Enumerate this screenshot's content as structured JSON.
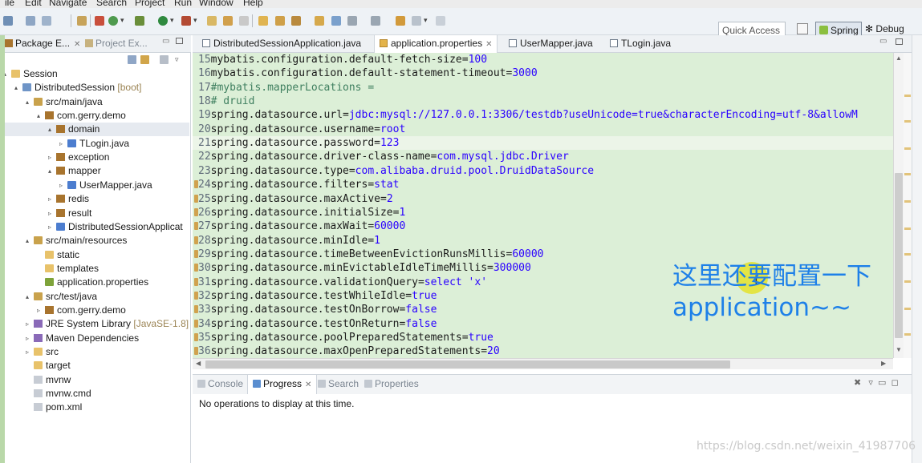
{
  "menubar": {
    "items": [
      "ile",
      "Edit",
      "Navigate",
      "Search",
      "Project",
      "Run",
      "Window",
      "Help"
    ]
  },
  "toolbar": {
    "quick_access_placeholder": "Quick Access",
    "perspectives": {
      "spring_label": "Spring",
      "debug_label": "Debug"
    }
  },
  "left_panel": {
    "tabs": [
      {
        "label": "Package E...",
        "icon": "package-explorer-icon"
      },
      {
        "label": "Project Ex...",
        "icon": "project-explorer-icon"
      }
    ],
    "tree": [
      {
        "label": "Session",
        "twisty": "▴",
        "icon": "folder-icon",
        "icon_class": "ti-folder"
      },
      {
        "label": "DistributedSession",
        "suffix": "[boot]",
        "twisty": "▴",
        "icon": "project-icon",
        "icon_class": "ti-proj"
      },
      {
        "label": "src/main/java",
        "twisty": "▴",
        "icon": "source-folder-icon",
        "icon_class": "ti-src"
      },
      {
        "label": "com.gerry.demo",
        "twisty": "▴",
        "icon": "package-icon",
        "icon_class": "ti-pkg"
      },
      {
        "label": "domain",
        "twisty": "▴",
        "icon": "package-icon",
        "icon_class": "ti-pkg",
        "selected": true
      },
      {
        "label": "TLogin.java",
        "twisty": "▹",
        "icon": "java-file-icon",
        "icon_class": "ti-java"
      },
      {
        "label": "exception",
        "twisty": "▹",
        "icon": "package-icon",
        "icon_class": "ti-pkg"
      },
      {
        "label": "mapper",
        "twisty": "▴",
        "icon": "package-icon",
        "icon_class": "ti-pkg"
      },
      {
        "label": "UserMapper.java",
        "twisty": "▹",
        "icon": "java-interface-icon",
        "icon_class": "ti-java"
      },
      {
        "label": "redis",
        "twisty": "▹",
        "icon": "package-icon",
        "icon_class": "ti-pkg"
      },
      {
        "label": "result",
        "twisty": "▹",
        "icon": "package-icon",
        "icon_class": "ti-pkg"
      },
      {
        "label": "DistributedSessionApplicat",
        "twisty": "▹",
        "icon": "java-file-icon",
        "icon_class": "ti-java"
      },
      {
        "label": "src/main/resources",
        "twisty": "▴",
        "icon": "source-folder-icon",
        "icon_class": "ti-src"
      },
      {
        "label": "static",
        "twisty": "",
        "icon": "folder-icon",
        "icon_class": "ti-folder"
      },
      {
        "label": "templates",
        "twisty": "",
        "icon": "folder-icon",
        "icon_class": "ti-folder"
      },
      {
        "label": "application.properties",
        "twisty": "",
        "icon": "properties-file-icon",
        "icon_class": "ti-props"
      },
      {
        "label": "src/test/java",
        "twisty": "▴",
        "icon": "source-folder-icon",
        "icon_class": "ti-src"
      },
      {
        "label": "com.gerry.demo",
        "twisty": "▹",
        "icon": "package-icon",
        "icon_class": "ti-pkg"
      },
      {
        "label": "JRE System Library",
        "suffix": "[JavaSE-1.8]",
        "twisty": "▹",
        "icon": "library-icon",
        "icon_class": "ti-lib"
      },
      {
        "label": "Maven Dependencies",
        "twisty": "▹",
        "icon": "library-icon",
        "icon_class": "ti-lib"
      },
      {
        "label": "src",
        "twisty": "▹",
        "icon": "folder-icon",
        "icon_class": "ti-folder"
      },
      {
        "label": "target",
        "twisty": "",
        "icon": "folder-icon",
        "icon_class": "ti-folder"
      },
      {
        "label": "mvnw",
        "twisty": "",
        "icon": "file-icon",
        "icon_class": "ti-file"
      },
      {
        "label": "mvnw.cmd",
        "twisty": "",
        "icon": "file-icon",
        "icon_class": "ti-file"
      },
      {
        "label": "pom.xml",
        "twisty": "",
        "icon": "xml-file-icon",
        "icon_class": "ti-file"
      }
    ]
  },
  "editor": {
    "tabs": [
      {
        "label": "DistributedSessionApplication.java",
        "active": false
      },
      {
        "label": "application.properties",
        "active": true
      },
      {
        "label": "UserMapper.java",
        "active": false
      },
      {
        "label": "TLogin.java",
        "active": false
      }
    ],
    "current_line": 21,
    "lines": [
      {
        "n": "15",
        "key": "mybatis.configuration.default-fetch-size",
        "val": "100"
      },
      {
        "n": "16",
        "key": "mybatis.configuration.default-statement-timeout",
        "val": "3000"
      },
      {
        "n": "17",
        "comment": "#mybatis.mapperLocations ="
      },
      {
        "n": "18",
        "comment": "# druid"
      },
      {
        "n": "19",
        "key": "spring.datasource.url",
        "val": "jdbc:mysql://127.0.0.1:3306/testdb?useUnicode=true&characterEncoding=utf-8&allowM"
      },
      {
        "n": "20",
        "key": "spring.datasource.username",
        "val": "root"
      },
      {
        "n": "21",
        "key": "spring.datasource.password",
        "val": "123"
      },
      {
        "n": "22",
        "key": "spring.datasource.driver-class-name",
        "val": "com.mysql.jdbc.Driver"
      },
      {
        "n": "23",
        "key": "spring.datasource.type",
        "val": "com.alibaba.druid.pool.DruidDataSource"
      },
      {
        "n": "24",
        "key": "spring.datasource.filters",
        "val": "stat",
        "marker": true
      },
      {
        "n": "25",
        "key": "spring.datasource.maxActive",
        "val": "2",
        "marker": true
      },
      {
        "n": "26",
        "key": "spring.datasource.initialSize",
        "val": "1",
        "marker": true
      },
      {
        "n": "27",
        "key": "spring.datasource.maxWait",
        "val": "60000",
        "marker": true
      },
      {
        "n": "28",
        "key": "spring.datasource.minIdle",
        "val": "1",
        "marker": true
      },
      {
        "n": "29",
        "key": "spring.datasource.timeBetweenEvictionRunsMillis",
        "val": "60000",
        "marker": true
      },
      {
        "n": "30",
        "key": "spring.datasource.minEvictableIdleTimeMillis",
        "val": "300000",
        "marker": true
      },
      {
        "n": "31",
        "key": "spring.datasource.validationQuery",
        "val": "select 'x'",
        "marker": true
      },
      {
        "n": "32",
        "key": "spring.datasource.testWhileIdle",
        "val": "true",
        "marker": true
      },
      {
        "n": "33",
        "key": "spring.datasource.testOnBorrow",
        "val": "false",
        "marker": true
      },
      {
        "n": "34",
        "key": "spring.datasource.testOnReturn",
        "val": "false",
        "marker": true
      },
      {
        "n": "35",
        "key": "spring.datasource.poolPreparedStatements",
        "val": "true",
        "marker": true
      },
      {
        "n": "36",
        "key": "spring.datasource.maxOpenPreparedStatements",
        "val": "20",
        "marker": true
      }
    ]
  },
  "annotation": {
    "line1": "这里还要配置一下",
    "line2": "application~~"
  },
  "bottom_panel": {
    "tabs": [
      {
        "label": "Console",
        "active": false
      },
      {
        "label": "Progress",
        "active": true
      },
      {
        "label": "Search",
        "active": false
      },
      {
        "label": "Properties",
        "active": false
      }
    ],
    "message": "No operations to display at this time."
  },
  "watermark": "https://blog.csdn.net/weixin_41987706",
  "colors": {
    "code_background": "#dcefd7",
    "annotation_text": "#1e80e8",
    "property_value": "#2a00ff",
    "comment": "#3f7f5f"
  }
}
